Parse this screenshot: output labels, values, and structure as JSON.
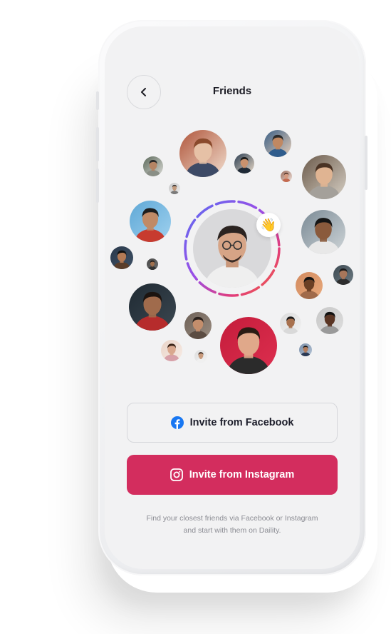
{
  "header": {
    "title": "Friends",
    "back_icon": "chevron-left-icon"
  },
  "hero": {
    "reaction_emoji": "👋",
    "ring_colors": [
      "#5b6cf0",
      "#9b4ee6",
      "#e23c7a",
      "#f0663e"
    ]
  },
  "actions": {
    "facebook_label": "Invite from Facebook",
    "facebook_icon": "facebook-icon",
    "facebook_color": "#1877f2",
    "instagram_label": "Invite from Instagram",
    "instagram_icon": "instagram-icon",
    "instagram_bg": "#d32d5e"
  },
  "footer": {
    "text": "Find your closest friends via Facebook or Instagram and start with them on Daility."
  }
}
